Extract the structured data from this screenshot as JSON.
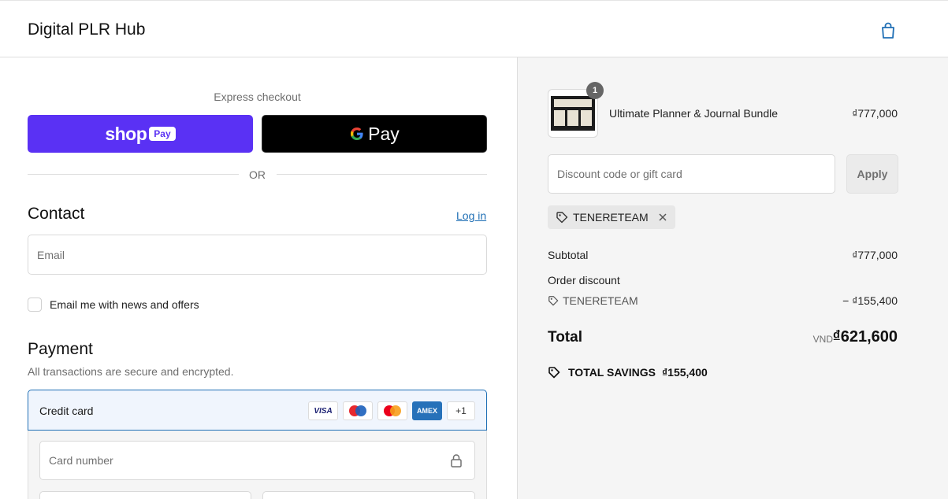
{
  "header": {
    "store_name": "Digital PLR Hub",
    "cart_icon": "shopping-bag-icon"
  },
  "express": {
    "label": "Express checkout",
    "shop_pay": {
      "word": "shop",
      "pill": "Pay",
      "color": "#5a31f4"
    },
    "google_pay": {
      "word": "Pay"
    },
    "separator": "OR"
  },
  "contact": {
    "heading": "Contact",
    "login_link": "Log in",
    "email_placeholder": "Email",
    "newsletter_label": "Email me with news and offers"
  },
  "payment": {
    "heading": "Payment",
    "subtitle": "All transactions are secure and encrypted.",
    "method_label": "Credit card",
    "card_brands": [
      "VISA",
      "maestro",
      "mastercard",
      "AMEX"
    ],
    "more_brands": "+1",
    "card_number_placeholder": "Card number"
  },
  "summary": {
    "product": {
      "name": "Ultimate Planner & Journal Bundle",
      "price": "₫777,000",
      "quantity": "1"
    },
    "discount_placeholder": "Discount code or gift card",
    "apply_label": "Apply",
    "applied_code": "TENERETEAM",
    "subtotal_label": "Subtotal",
    "subtotal_value": "₫777,000",
    "order_discount_label": "Order discount",
    "discount_code": "TENERETEAM",
    "discount_value": "− ₫155,400",
    "total_label": "Total",
    "total_currency": "VND",
    "total_value": "₫621,600",
    "savings_label": "TOTAL SAVINGS",
    "savings_value": "₫155,400"
  },
  "colors": {
    "accent": "#1f6fb5",
    "shop_pay": "#5a31f4",
    "panel_bg": "#f5f5f5"
  }
}
